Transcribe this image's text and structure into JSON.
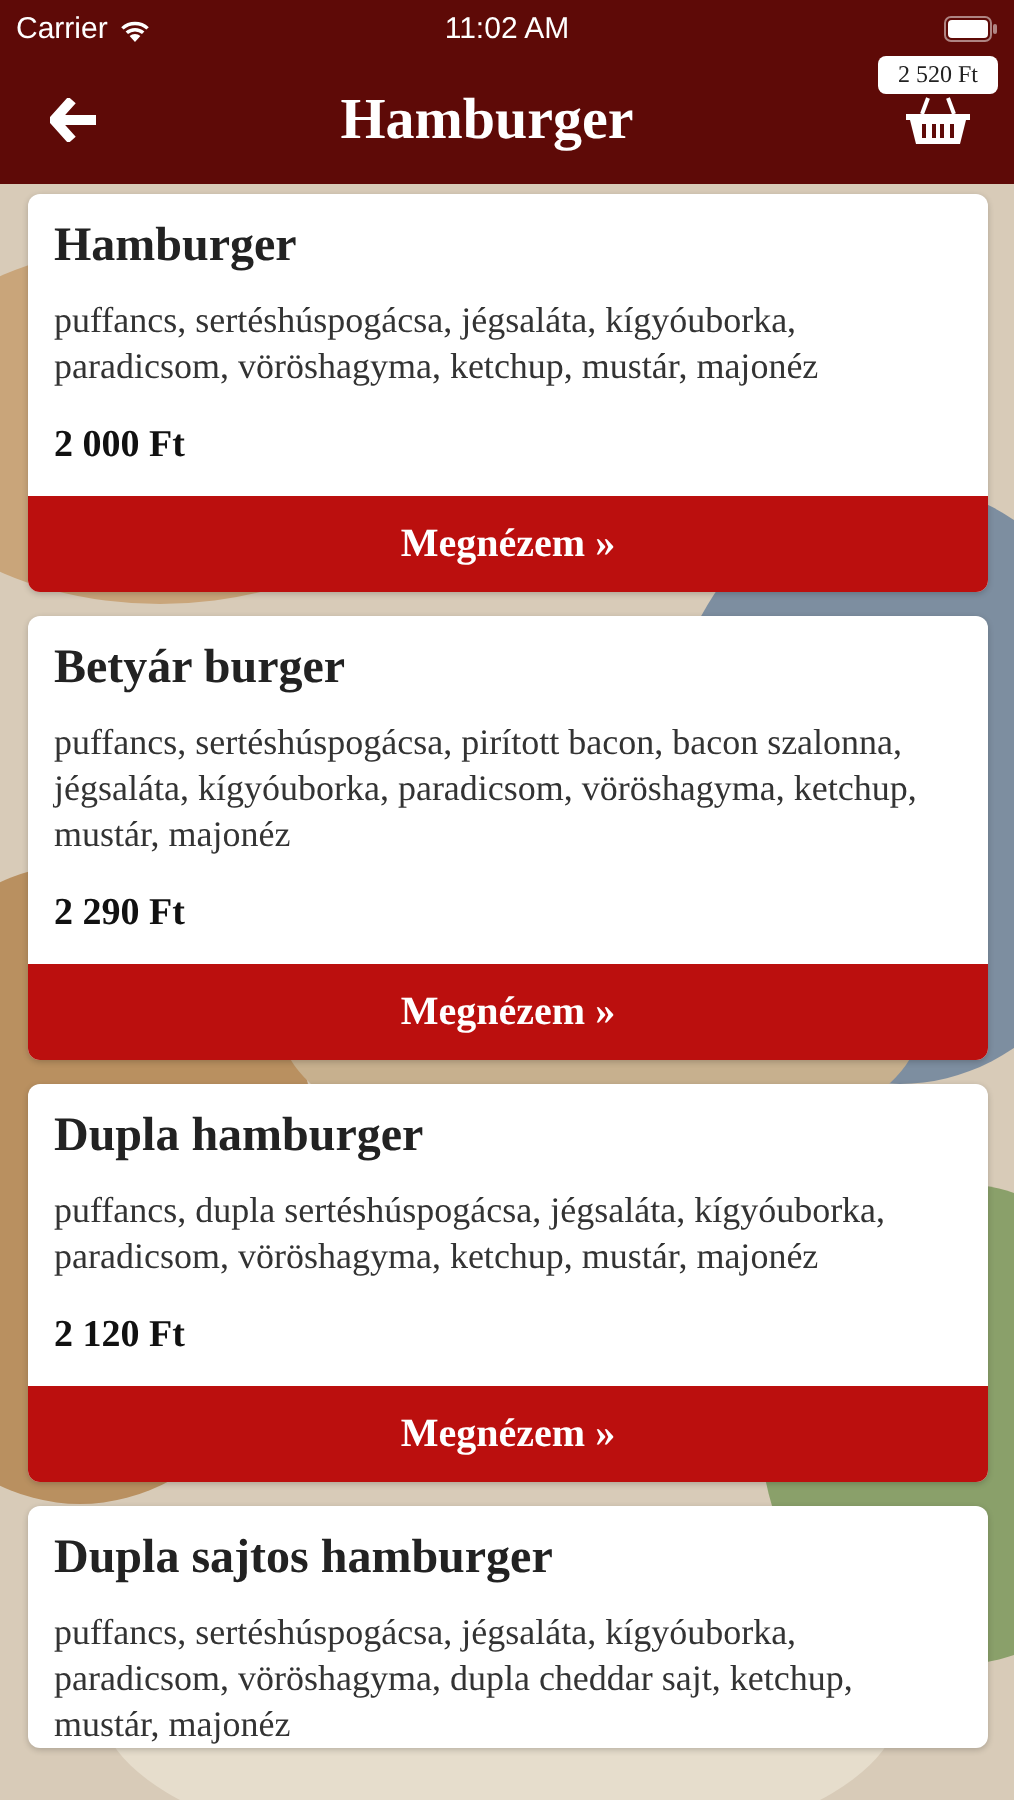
{
  "status_bar": {
    "carrier": "Carrier",
    "time": "11:02 AM"
  },
  "header": {
    "title": "Hamburger",
    "cart_total": "2 520 Ft"
  },
  "products": [
    {
      "name": "Hamburger",
      "description": "puffancs, sertéshúspogácsa, jégsaláta, kígyóuborka, paradicsom, vöröshagyma, ketchup, mustár, majonéz",
      "price": "2 000 Ft",
      "button": "Megnézem »"
    },
    {
      "name": "Betyár burger",
      "description": "puffancs, sertéshúspogácsa, pirított bacon, bacon szalonna, jégsaláta, kígyóuborka, paradicsom, vöröshagyma, ketchup, mustár, majonéz",
      "price": "2 290 Ft",
      "button": "Megnézem »"
    },
    {
      "name": "Dupla hamburger",
      "description": "puffancs, dupla sertéshúspogácsa, jégsaláta, kígyóuborka, paradicsom, vöröshagyma, ketchup, mustár, majonéz",
      "price": "2 120 Ft",
      "button": "Megnézem »"
    },
    {
      "name": "Dupla sajtos hamburger",
      "description": "puffancs, sertéshúspogácsa, jégsaláta, kígyóuborka, paradicsom, vöröshagyma, dupla cheddar sajt, ketchup, mustár, majonéz"
    }
  ]
}
